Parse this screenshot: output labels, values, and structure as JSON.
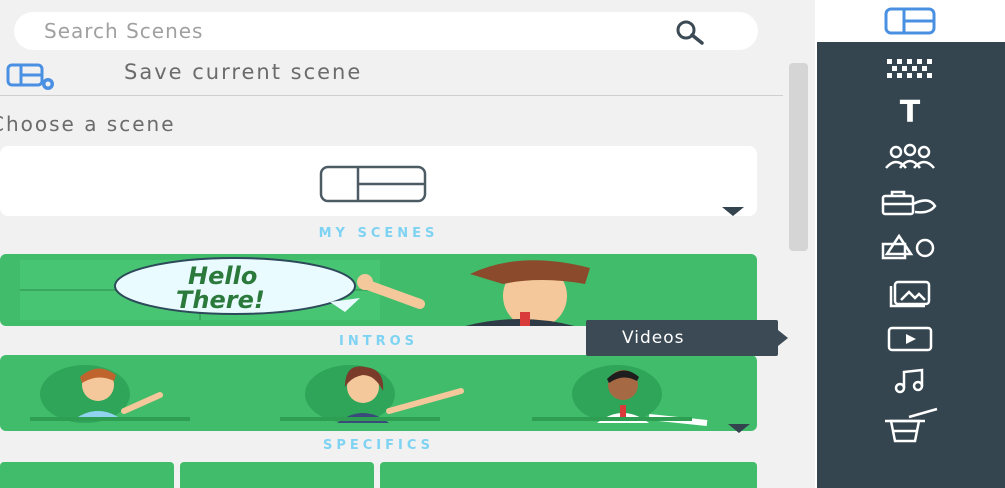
{
  "search": {
    "placeholder": "Search Scenes"
  },
  "actions": {
    "save_label": "Save current scene"
  },
  "scene_picker": {
    "choose_label": "Choose a scene"
  },
  "sections": {
    "my_scenes": "MY SCENES",
    "intros": "INTROS",
    "specifics": "SPECIFICS"
  },
  "banner": {
    "speech_text_1": "Hello",
    "speech_text_2": "There!"
  },
  "tooltip": {
    "label": "Videos"
  },
  "toolbar": {
    "items": [
      {
        "name": "scenes-icon"
      },
      {
        "name": "backgrounds-icon"
      },
      {
        "name": "text-icon",
        "glyph": "T"
      },
      {
        "name": "characters-icon"
      },
      {
        "name": "props-icon"
      },
      {
        "name": "shapes-icon"
      },
      {
        "name": "images-icon"
      },
      {
        "name": "videos-icon"
      },
      {
        "name": "music-icon"
      },
      {
        "name": "magic-hat-icon"
      }
    ]
  },
  "colors": {
    "accent": "#4a90e2",
    "green": "#41bc6a",
    "dark": "#34454f",
    "section_title": "#7fd3f2"
  }
}
